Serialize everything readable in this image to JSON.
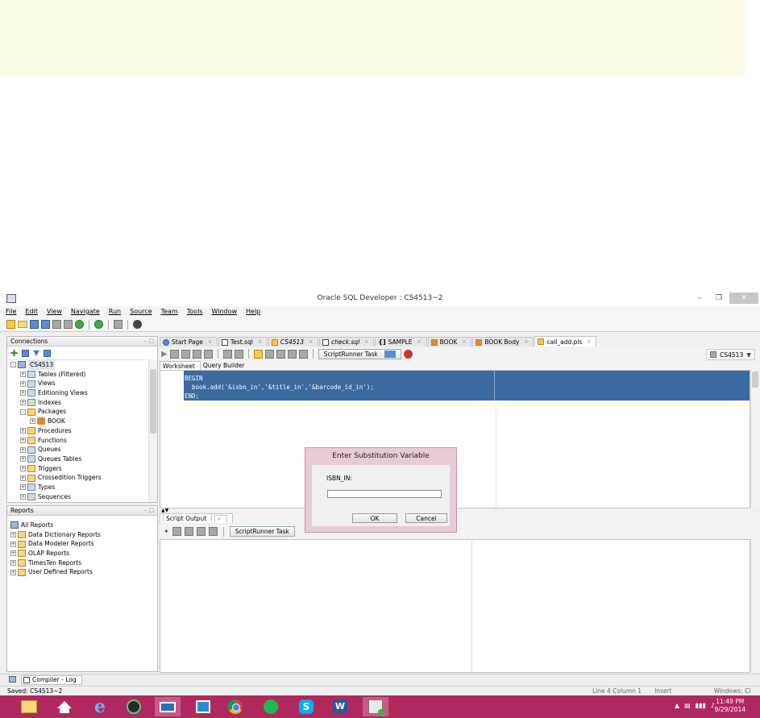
{
  "window": {
    "title": "Oracle SQL Developer : CS4513~2"
  },
  "menu": [
    "File",
    "Edit",
    "View",
    "Navigate",
    "Run",
    "Source",
    "Team",
    "Tools",
    "Window",
    "Help"
  ],
  "connections_panel": {
    "title": "Connections",
    "root": "CS4513",
    "items": [
      "Tables (Filtered)",
      "Views",
      "Editioning Views",
      "Indexes",
      "Packages",
      "BOOK",
      "Procedures",
      "Functions",
      "Queues",
      "Queues Tables",
      "Triggers",
      "Crossedition Triggers",
      "Types",
      "Sequences"
    ]
  },
  "reports_panel": {
    "title": "Reports",
    "items": [
      "All Reports",
      "Data Dictionary Reports",
      "Data Modeler Reports",
      "OLAP Reports",
      "TimesTen Reports",
      "User Defined Reports"
    ]
  },
  "tabs": [
    {
      "label": "Start Page",
      "italic": false
    },
    {
      "label": "Test.sql",
      "italic": false
    },
    {
      "label": "CS4513",
      "italic": true
    },
    {
      "label": "check.sql",
      "italic": true
    },
    {
      "label": "SAMPLE",
      "italic": false
    },
    {
      "label": "BOOK",
      "italic": false
    },
    {
      "label": "BOOK Body",
      "italic": false
    },
    {
      "label": "call_add.pls",
      "italic": false,
      "active": true
    }
  ],
  "editor_toolbar": {
    "runner_label": "ScriptRunner Task",
    "connection": "CS4513"
  },
  "subtabs": {
    "worksheet": "Worksheet",
    "query_builder": "Query Builder"
  },
  "code_lines": [
    "BEGIN",
    "  book.add('&isbn_in','&title_in','&barcode_id_in');",
    "END;"
  ],
  "output": {
    "tab": "Script Output",
    "runner_label": "ScriptRunner Task"
  },
  "dialog": {
    "title": "Enter Substitution Variable",
    "label": "ISBN_IN:",
    "value": "",
    "ok": "OK",
    "cancel": "Cancel"
  },
  "lower_tab": "Compiler - Log",
  "status": {
    "left": "Saved: CS4513~2",
    "line_col": "Line 4 Column 1",
    "mode": "Insert",
    "encoding": "Windows: Cl"
  },
  "clock": {
    "time": "11:49 PM",
    "date": "9/29/2014"
  },
  "colors": {
    "taskbar": "#b0295e",
    "selection": "#3b6aa0",
    "banner": "#fdfae6",
    "dialog": "#e8cbd8"
  }
}
